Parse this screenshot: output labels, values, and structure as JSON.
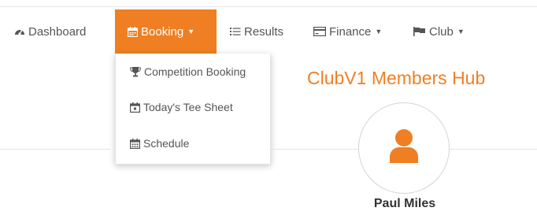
{
  "colors": {
    "accent": "#ef7f22",
    "text": "#555555",
    "name_text": "#333333",
    "active_text": "#ffffff"
  },
  "nav": {
    "items": [
      {
        "label": "Dashboard",
        "icon": "tachometer-icon"
      },
      {
        "label": "Booking",
        "icon": "calendar-icon",
        "active": true,
        "has_caret": true
      },
      {
        "label": "Results",
        "icon": "list-icon"
      },
      {
        "label": "Finance",
        "icon": "credit-card-icon",
        "has_caret": true
      },
      {
        "label": "Club",
        "icon": "flag-icon",
        "has_caret": true
      }
    ]
  },
  "booking_menu": {
    "items": [
      {
        "label": "Competition Booking",
        "icon": "trophy-icon"
      },
      {
        "label": "Today's Tee Sheet",
        "icon": "calendar-day-icon"
      },
      {
        "label": "Schedule",
        "icon": "calendar-icon"
      }
    ]
  },
  "hub": {
    "title": "ClubV1 Members Hub"
  },
  "user": {
    "name": "Paul Miles",
    "avatar_icon": "user-icon"
  }
}
